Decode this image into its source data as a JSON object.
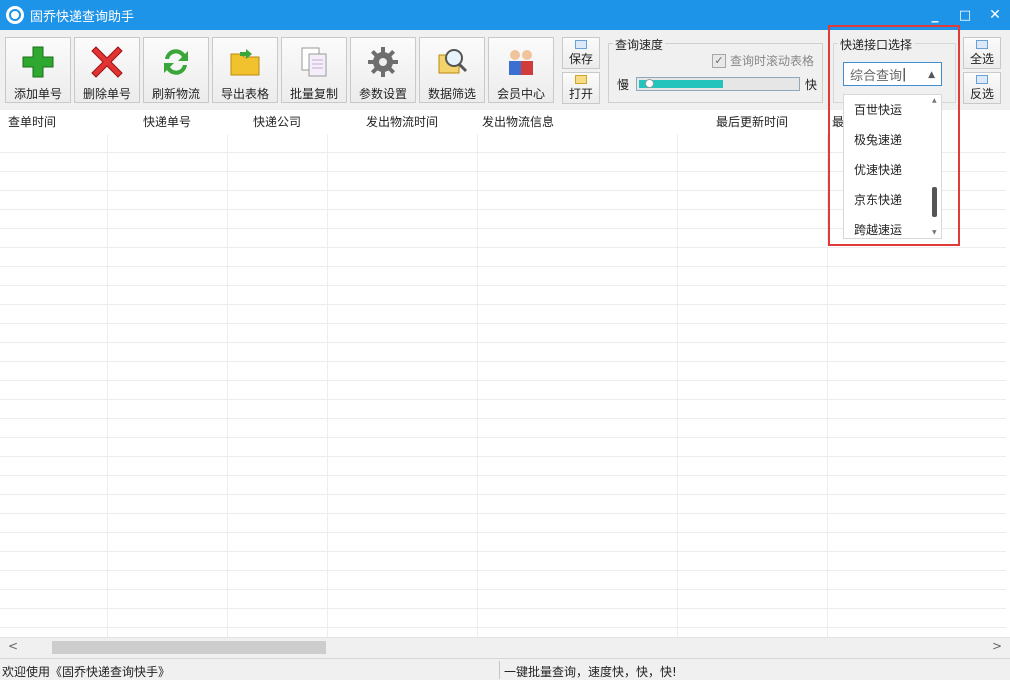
{
  "window": {
    "title": "固乔快递查询助手",
    "controls": [
      "_",
      "□",
      "✕"
    ]
  },
  "toolbar": {
    "buttons": [
      {
        "label": "添加单号",
        "icon": "plus-icon"
      },
      {
        "label": "删除单号",
        "icon": "delete-x-icon"
      },
      {
        "label": "刷新物流",
        "icon": "refresh-icon"
      },
      {
        "label": "导出表格",
        "icon": "folder-export-icon"
      },
      {
        "label": "批量复制",
        "icon": "copy-icon"
      },
      {
        "label": "参数设置",
        "icon": "gear-icon"
      },
      {
        "label": "数据筛选",
        "icon": "magnifier-filter-icon"
      },
      {
        "label": "会员中心",
        "icon": "members-icon"
      }
    ],
    "save_label": "保存",
    "open_label": "打开",
    "select_all_label": "全选",
    "invert_label": "反选"
  },
  "speed": {
    "title": "查询速度",
    "scroll_checkbox_label": "查询时滚动表格",
    "scroll_checked": true,
    "slow_label": "慢",
    "fast_label": "快",
    "level": 0.6
  },
  "interface": {
    "title": "快递接口选择",
    "selected": "综合查询",
    "options": [
      "百世快运",
      "极兔速递",
      "优速快递",
      "京东快递",
      "跨越速运"
    ]
  },
  "table": {
    "columns": [
      "查单时间",
      "快递单号",
      "快递公司",
      "发出物流时间",
      "发出物流信息",
      "最后更新时间",
      "最"
    ],
    "rows": []
  },
  "status": {
    "left": "欢迎使用《固乔快递查询快手》",
    "right": "一键批量查询，速度快，快，快!"
  },
  "colors": {
    "titlebar": "#1e94e8",
    "highlight": "#e03a3a",
    "slider_fill": "#23c4bc"
  }
}
